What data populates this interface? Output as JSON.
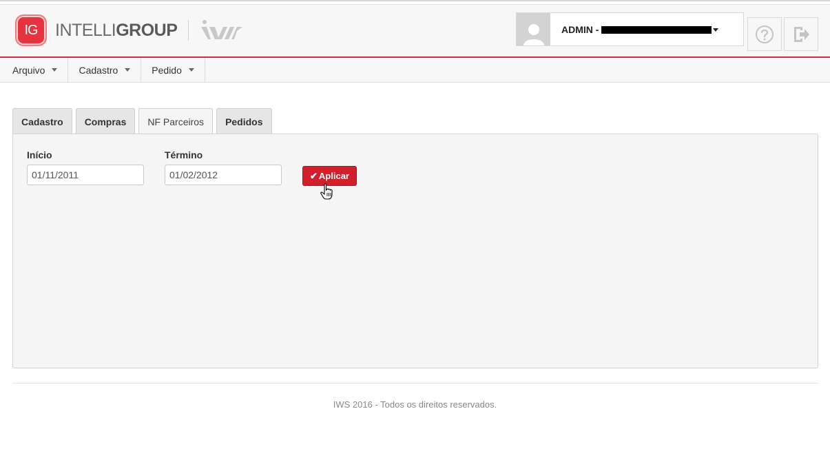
{
  "header": {
    "logo_initials": "IG",
    "logo_text_light": "INTELLI",
    "logo_text_bold": "GROUP",
    "user_label": "ADMIN -",
    "help_icon": "question-circle-icon",
    "logout_icon": "sign-out-icon"
  },
  "menu": {
    "items": [
      {
        "label": "Arquivo"
      },
      {
        "label": "Cadastro"
      },
      {
        "label": "Pedido"
      }
    ]
  },
  "tabs": [
    {
      "label": "Cadastro",
      "active": false
    },
    {
      "label": "Compras",
      "active": false
    },
    {
      "label": "NF Parceiros",
      "active": true
    },
    {
      "label": "Pedidos",
      "active": false
    }
  ],
  "form": {
    "start_label": "Início",
    "start_value": "01/11/2011",
    "end_label": "Término",
    "end_value": "01/02/2012",
    "apply_label": "Aplicar"
  },
  "footer": {
    "text": "IWS 2016 - Todos os direitos reservados."
  },
  "colors": {
    "accent": "#d21f2c",
    "header_border": "#d7263d",
    "logo": "#e5333f"
  }
}
